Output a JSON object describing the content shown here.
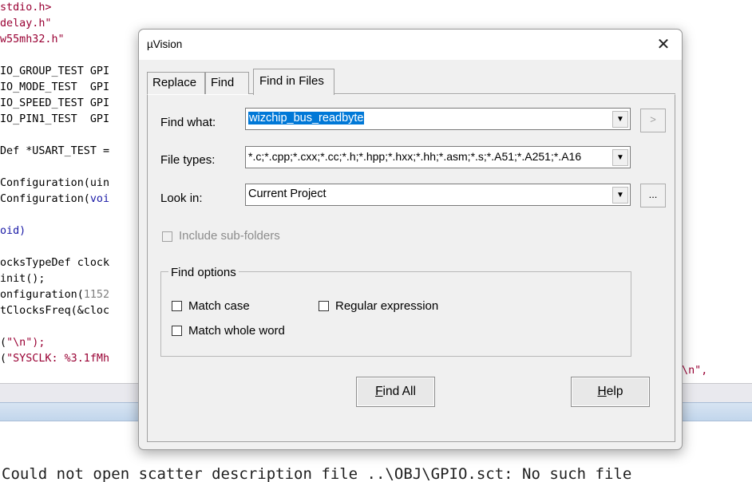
{
  "editor": {
    "lines": [
      {
        "prefix": "stdio.h>",
        "rest": "",
        "cls": "kw-red"
      },
      {
        "prefix": "delay.h\"",
        "rest": "",
        "cls": "kw-red"
      },
      {
        "prefix": "w55mh32.h\"",
        "rest": "",
        "cls": "kw-red"
      },
      {
        "prefix": "",
        "rest": "",
        "cls": ""
      },
      {
        "prefix": "IO_GROUP_TEST GPI",
        "rest": "",
        "cls": ""
      },
      {
        "prefix": "IO_MODE_TEST  GPI",
        "rest": "",
        "cls": ""
      },
      {
        "prefix": "IO_SPEED_TEST GPI",
        "rest": "",
        "cls": ""
      },
      {
        "prefix": "IO_PIN1_TEST  GPI",
        "rest": "",
        "cls": ""
      },
      {
        "prefix": "",
        "rest": "",
        "cls": ""
      },
      {
        "prefix": "Def *USART_TEST =",
        "rest": "",
        "cls": ""
      },
      {
        "prefix": "",
        "rest": "",
        "cls": ""
      },
      {
        "prefix": "Configuration(uin",
        "rest": "",
        "cls": ""
      },
      {
        "prefix": "Configuration(",
        "rest": "voi",
        "cls": "kw-blue"
      },
      {
        "prefix": "",
        "rest": "",
        "cls": ""
      },
      {
        "prefix": "oid)",
        "rest": "",
        "cls": "kw-blue"
      },
      {
        "prefix": "",
        "rest": "",
        "cls": ""
      },
      {
        "prefix": "ocksTypeDef clock",
        "rest": "",
        "cls": ""
      },
      {
        "prefix": "init();",
        "rest": "",
        "cls": ""
      },
      {
        "prefix": "onfiguration(",
        "rest": "1152",
        "cls": "kw-num"
      },
      {
        "prefix": "tClocksFreq(&cloc",
        "rest": "",
        "cls": ""
      },
      {
        "prefix": "",
        "rest": "",
        "cls": ""
      },
      {
        "prefix": "(",
        "rest": "\"\\n\");",
        "cls": "kw-red"
      },
      {
        "prefix": "(",
        "rest": "\"SYSCLK: %3.1fMh",
        "cls": "kw-red"
      }
    ],
    "right_fragment": "z\\n\","
  },
  "output": {
    "line": "Could not open scatter description file ..\\OBJ\\GPIO.sct: No such file"
  },
  "dialog": {
    "title": "µVision",
    "close_symbol": "✕",
    "tabs": [
      "Replace",
      "Find",
      "Find in Files"
    ],
    "active_tab": "Find in Files",
    "find_what": {
      "label": "Find what:",
      "value": "wizchip_bus_readbyte",
      "button": ">"
    },
    "file_types": {
      "label": "File types:",
      "value": "*.c;*.cpp;*.cxx;*.cc;*.h;*.hpp;*.hxx;*.hh;*.asm;*.s;*.A51;*.A251;*.A16"
    },
    "look_in": {
      "label": "Look in:",
      "value": "Current Project",
      "button": "..."
    },
    "include_subfolders": {
      "label": "Include sub-folders",
      "checked": false,
      "enabled": false
    },
    "find_options": {
      "title": "Find options",
      "match_case": {
        "label": "Match case",
        "checked": false
      },
      "regular_expression": {
        "label": "Regular expression",
        "checked": false
      },
      "match_whole_word": {
        "label": "Match whole word",
        "checked": false
      }
    },
    "buttons": {
      "find_all": {
        "mnemonic": "F",
        "rest": "ind All"
      },
      "help": {
        "mnemonic": "H",
        "rest": "elp"
      }
    },
    "dropdown_arrow": "▼"
  }
}
